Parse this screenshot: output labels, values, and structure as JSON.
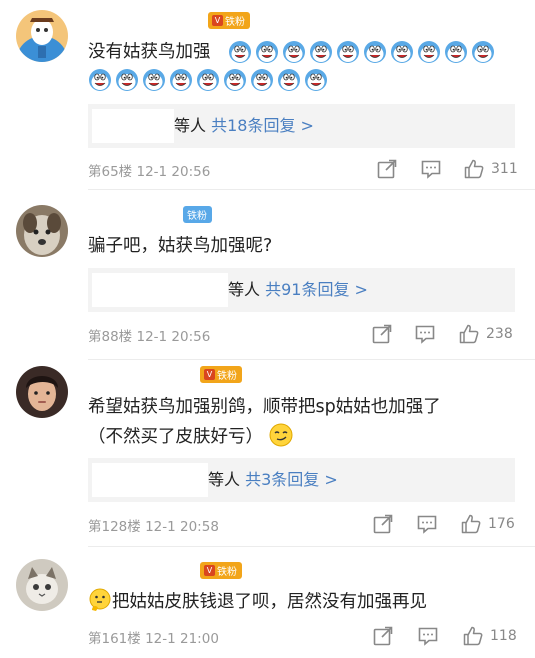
{
  "comments": [
    {
      "badge": "铁粉",
      "text": "没有姑获鸟加强",
      "emoji_count": 19,
      "reply_summary": "等人",
      "reply_link": "共18条回复 >",
      "floor": "第65楼",
      "time": "12-1 20:56",
      "likes": "311"
    },
    {
      "badge": "铁粉",
      "text": "骗子吧，姑获鸟加强呢?",
      "reply_summary": "等人",
      "reply_link": "共91条回复 >",
      "floor": "第88楼",
      "time": "12-1 20:56",
      "likes": "238"
    },
    {
      "badge": "铁粉",
      "text_line1": "希望姑获鸟加强别鸽，顺带把sp姑姑也加强了",
      "text_line2": "（不然买了皮肤好亏）",
      "reply_summary": "等人",
      "reply_link": "共3条回复 >",
      "floor": "第128楼",
      "time": "12-1 20:58",
      "likes": "176"
    },
    {
      "badge": "铁粉",
      "text": "把姑姑皮肤钱退了呗，居然没有加强再见",
      "floor": "第161楼",
      "time": "12-1 21:00",
      "likes": "118"
    }
  ],
  "colors": {
    "link": "#4a7fc1",
    "meta": "#9a9a9a",
    "badge_gold": "#f2a51a",
    "badge_blue": "#58a8e8",
    "reply_bg": "#f3f3f3"
  },
  "icons": [
    "share-icon",
    "comment-icon",
    "thumbs-up-icon",
    "emoji-icon"
  ]
}
